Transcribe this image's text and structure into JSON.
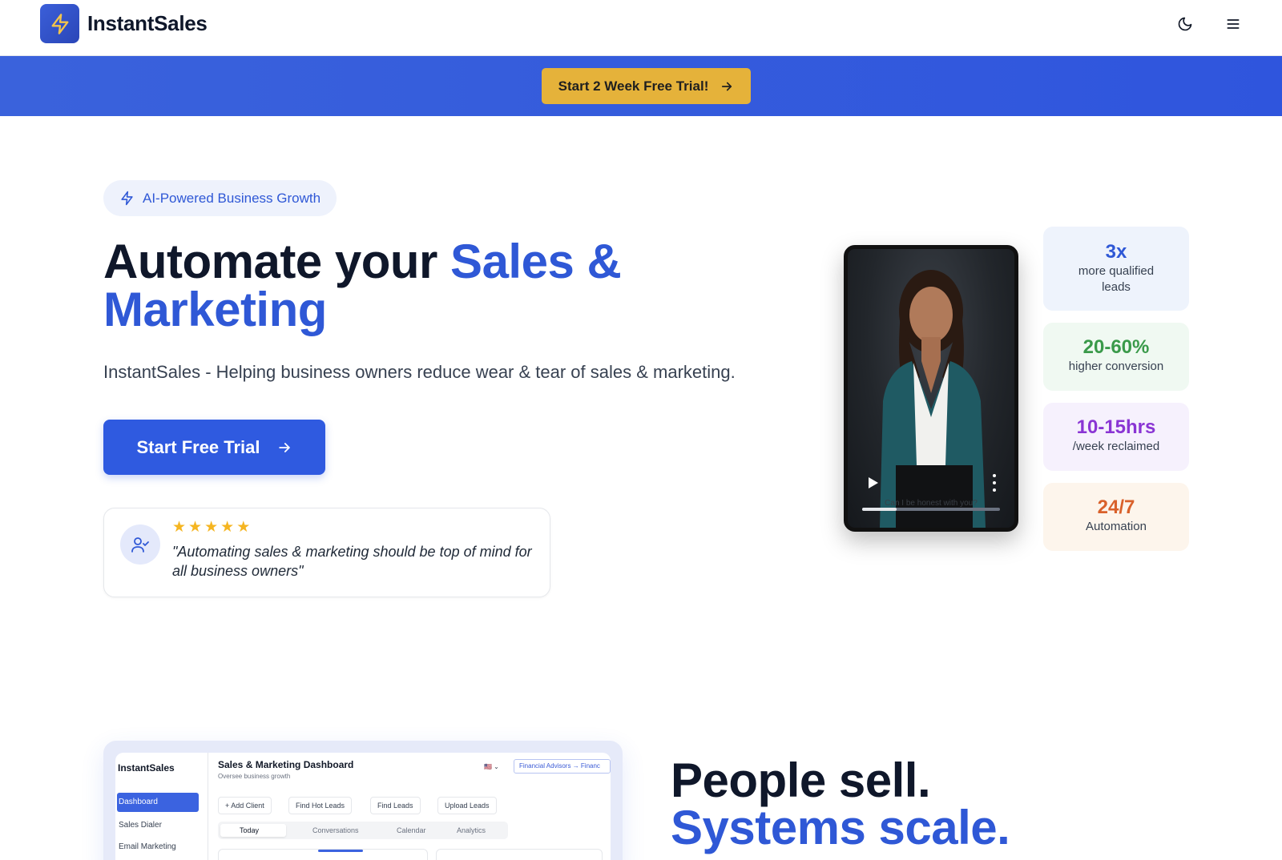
{
  "header": {
    "brand": "InstantSales",
    "icons": [
      "lightning-icon",
      "moon-icon",
      "menu-icon"
    ]
  },
  "banner": {
    "cta_label": "Start 2 Week Free Trial!"
  },
  "hero": {
    "pill_label": "AI-Powered Business Growth",
    "title_plain": "Automate your ",
    "title_accent": "Sales & Marketing",
    "subtitle": "InstantSales - Helping business owners reduce wear & tear of sales & marketing.",
    "cta_label": "Start Free Trial",
    "testimonial": {
      "stars": 5,
      "quote": "\"Automating sales & marketing should be top of mind for all business owners\""
    }
  },
  "video": {
    "caption": "Can I be honest with you?",
    "progress": 0.25
  },
  "stats": [
    {
      "value": "3x",
      "label": "more qualified leads",
      "color": "#2f58d6",
      "bg": "#eef3fc"
    },
    {
      "value": "20-60%",
      "label": "higher conversion",
      "color": "#3a9a4a",
      "bg": "#f0f9f2"
    },
    {
      "value": "10-15hrs",
      "label": "/week reclaimed",
      "color": "#8a35d4",
      "bg": "#f6f1fd"
    },
    {
      "value": "24/7",
      "label": "Automation",
      "color": "#d9612b",
      "bg": "#fdf5ec"
    }
  ],
  "dashboard": {
    "brand": "InstantSales",
    "nav": [
      "Dashboard",
      "Sales Dialer",
      "Email Marketing"
    ],
    "title": "Sales & Marketing Dashboard",
    "subtitle": "Oversee business growth",
    "flag": "🇺🇸 ⌄",
    "filter": "Financial Advisors → Financ",
    "actions": [
      "+ Add Client",
      "Find Hot Leads",
      "Find Leads",
      "Upload Leads"
    ],
    "tabs": [
      "Today",
      "Conversations",
      "Calendar",
      "Analytics"
    ]
  },
  "lower": {
    "line1": "People sell.",
    "line2": "Systems scale."
  },
  "colors": {
    "primary": "#2f58d6",
    "banner": "#3a62dc",
    "banner_button": "#e5b23a",
    "star": "#f5b521"
  }
}
